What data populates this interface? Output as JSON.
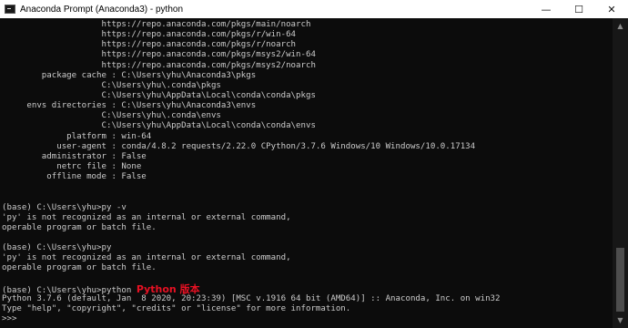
{
  "window": {
    "title": "Anaconda Prompt (Anaconda3) - python",
    "minimize_glyph": "—",
    "maximize_glyph": "☐",
    "close_glyph": "✕"
  },
  "terminal": {
    "lines": [
      "                    https://repo.anaconda.com/pkgs/main/noarch",
      "                    https://repo.anaconda.com/pkgs/r/win-64",
      "                    https://repo.anaconda.com/pkgs/r/noarch",
      "                    https://repo.anaconda.com/pkgs/msys2/win-64",
      "                    https://repo.anaconda.com/pkgs/msys2/noarch",
      "        package cache : C:\\Users\\yhu\\Anaconda3\\pkgs",
      "                    C:\\Users\\yhu\\.conda\\pkgs",
      "                    C:\\Users\\yhu\\AppData\\Local\\conda\\conda\\pkgs",
      "     envs directories : C:\\Users\\yhu\\Anaconda3\\envs",
      "                    C:\\Users\\yhu\\.conda\\envs",
      "                    C:\\Users\\yhu\\AppData\\Local\\conda\\conda\\envs",
      "             platform : win-64",
      "           user-agent : conda/4.8.2 requests/2.22.0 CPython/3.7.6 Windows/10 Windows/10.0.17134",
      "        administrator : False",
      "           netrc file : None",
      "         offline mode : False",
      "",
      "",
      "(base) C:\\Users\\yhu>py -v",
      "'py' is not recognized as an internal or external command,",
      "operable program or batch file.",
      "",
      "(base) C:\\Users\\yhu>py",
      "'py' is not recognized as an internal or external command,",
      "operable program or batch file.",
      "",
      "(base) C:\\Users\\yhu>python ",
      "Python 3.7.6 (default, Jan  8 2020, 20:23:39) [MSC v.1916 64 bit (AMD64)] :: Anaconda, Inc. on win32",
      "Type \"help\", \"copyright\", \"credits\" or \"license\" for more information.",
      ">>> "
    ],
    "annotation": "Python 版本"
  },
  "scrollbar": {
    "up_glyph": "▲",
    "down_glyph": "▼"
  },
  "colors": {
    "background": "#0c0c0c",
    "text": "#cccccc",
    "annotation": "#e81123"
  }
}
